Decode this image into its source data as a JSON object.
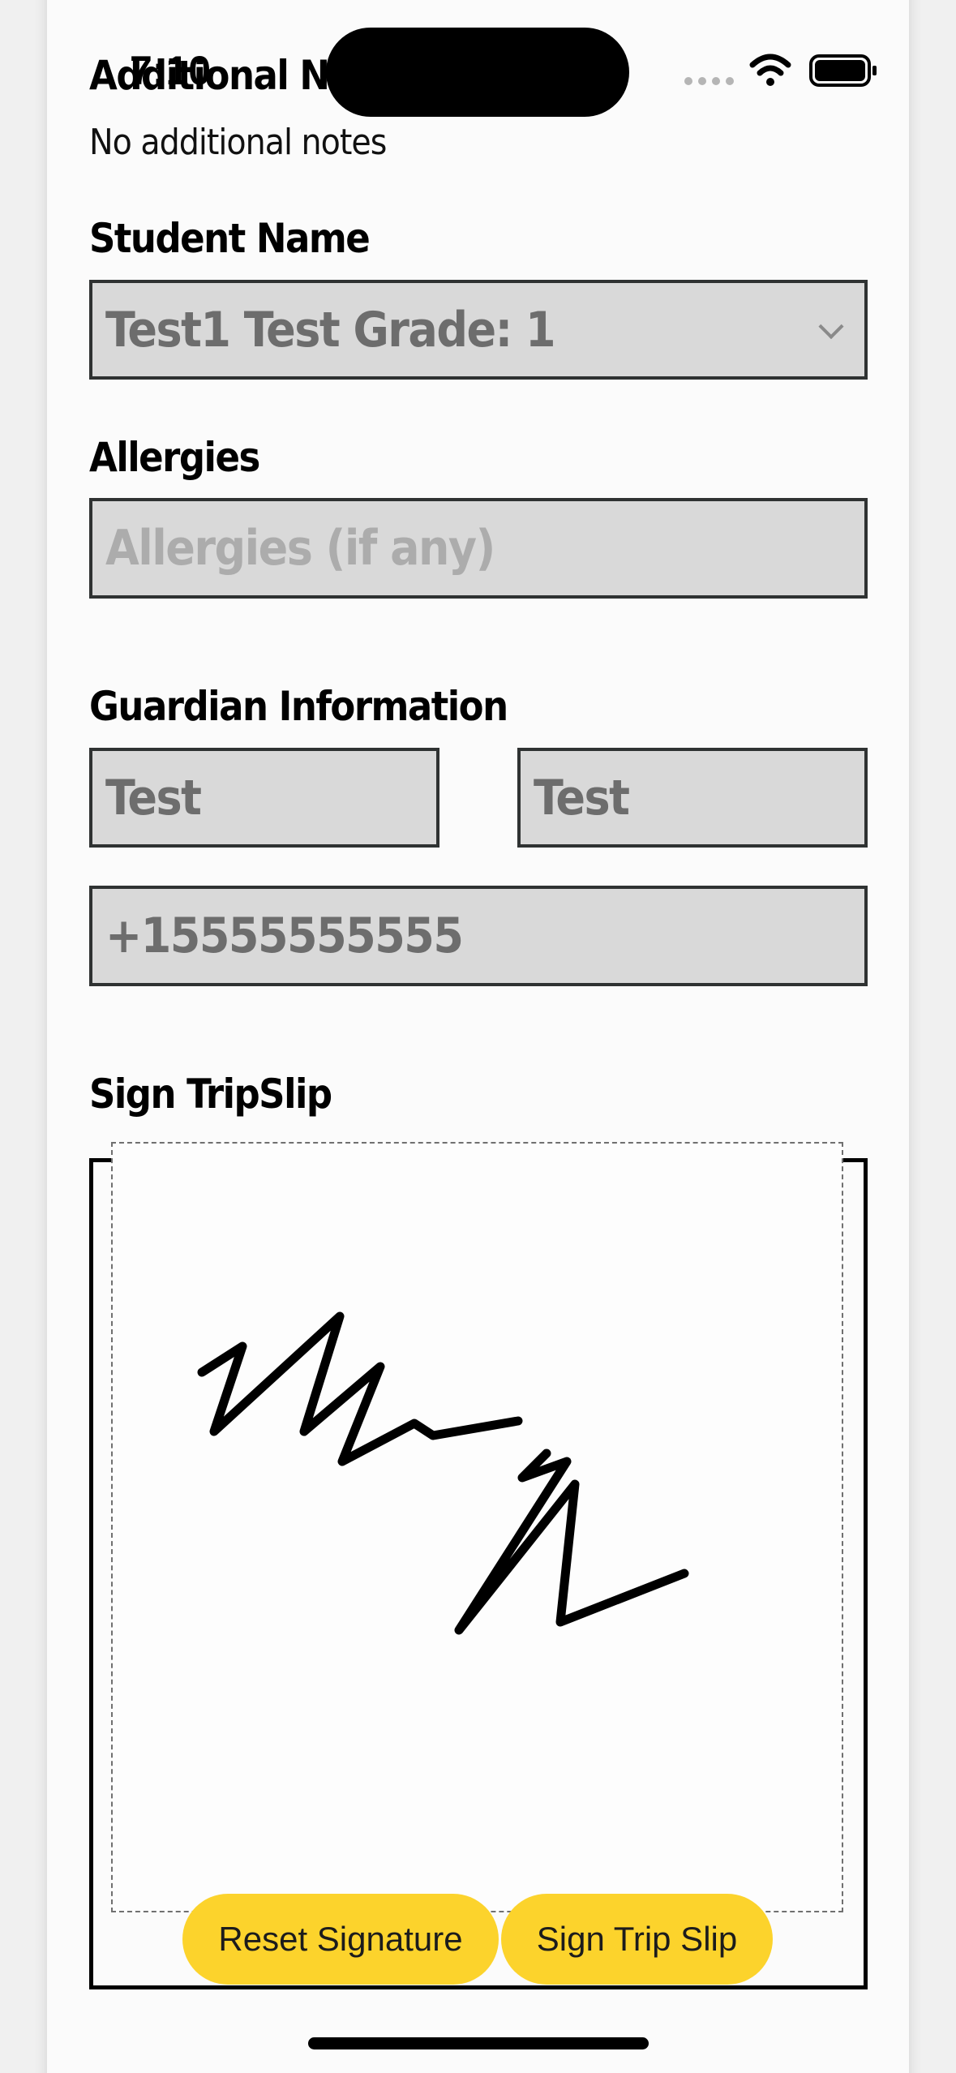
{
  "status_bar": {
    "time": "7:10"
  },
  "form": {
    "additional_notes_label": "Additional Notes",
    "additional_notes_value": "No additional notes",
    "student_name_label": "Student Name",
    "student_select_value": "Test1 Test Grade: 1",
    "allergies_label": "Allergies",
    "allergies_placeholder": "Allergies (if any)",
    "guardian_label": "Guardian Information",
    "guardian_first_name": "Test",
    "guardian_last_name": "Test",
    "guardian_phone": "+15555555555",
    "sign_label": "Sign TripSlip"
  },
  "buttons": {
    "reset_signature": "Reset Signature",
    "sign_trip_slip": "Sign Trip Slip"
  },
  "colors": {
    "button_yellow": "#fcd32c",
    "field_bg": "#d9d9d9",
    "field_border": "#2f3232"
  },
  "icons": {
    "select_arrow": "chevron-down-icon",
    "wifi": "wifi-icon",
    "battery": "battery-icon"
  }
}
